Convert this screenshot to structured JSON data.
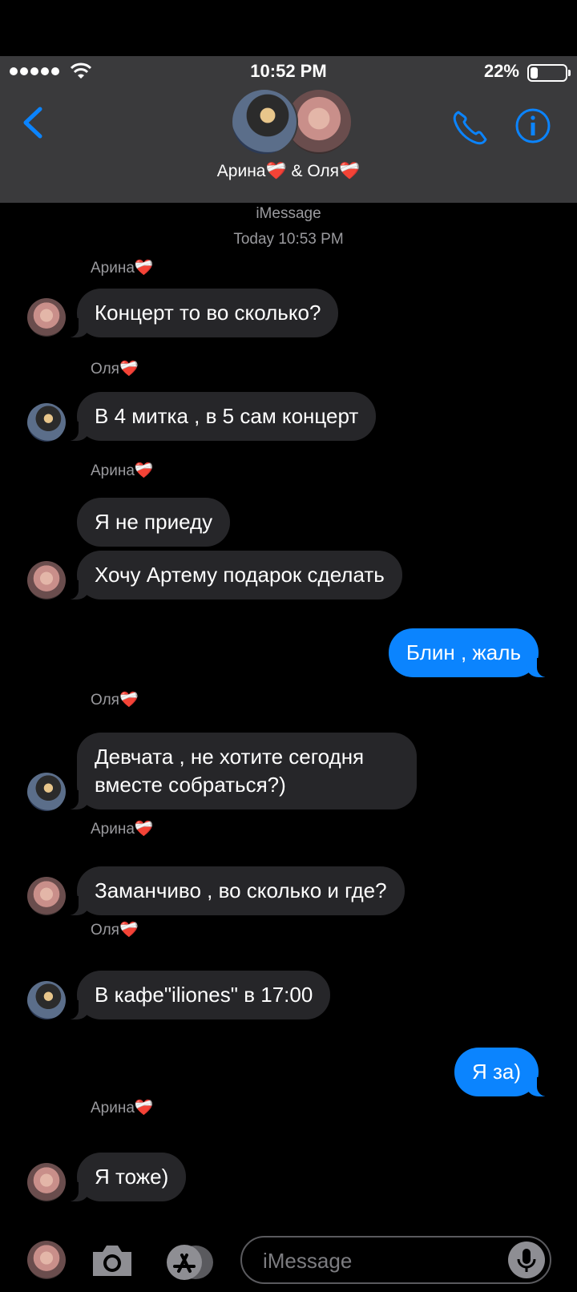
{
  "status": {
    "time": "10:52 PM",
    "battery": "22%",
    "battery_level": 0.22
  },
  "header": {
    "title": "Арина❤️‍🩹 & Оля❤️‍🩹",
    "accent": "#0b84fe"
  },
  "thread": {
    "service": "iMessage",
    "timestamp": "Today 10:53 PM"
  },
  "messages": [
    {
      "sender": "Арина❤️‍🩹",
      "text": "Концерт то во сколько?"
    },
    {
      "sender": "Оля❤️‍🩹",
      "text": "В 4 митка , в 5 сам концерт"
    },
    {
      "sender": "Арина❤️‍🩹",
      "text": "Я не приеду"
    },
    {
      "text": "Хочу Артему подарок сделать"
    },
    {
      "outgoing": true,
      "text": "Блин , жаль"
    },
    {
      "sender": "Оля❤️‍🩹",
      "text": "Девчата , не хотите сегодня вместе собраться?)"
    },
    {
      "sender": "Арина❤️‍🩹",
      "text": "Заманчиво , во сколько и где?"
    },
    {
      "sender": "Оля❤️‍🩹",
      "text": "В кафе\"iliones\" в 17:00"
    },
    {
      "outgoing": true,
      "text": "Я за)"
    },
    {
      "sender": "Арина❤️‍🩹",
      "text": "Я тоже)"
    }
  ],
  "composer": {
    "placeholder": "iMessage"
  }
}
